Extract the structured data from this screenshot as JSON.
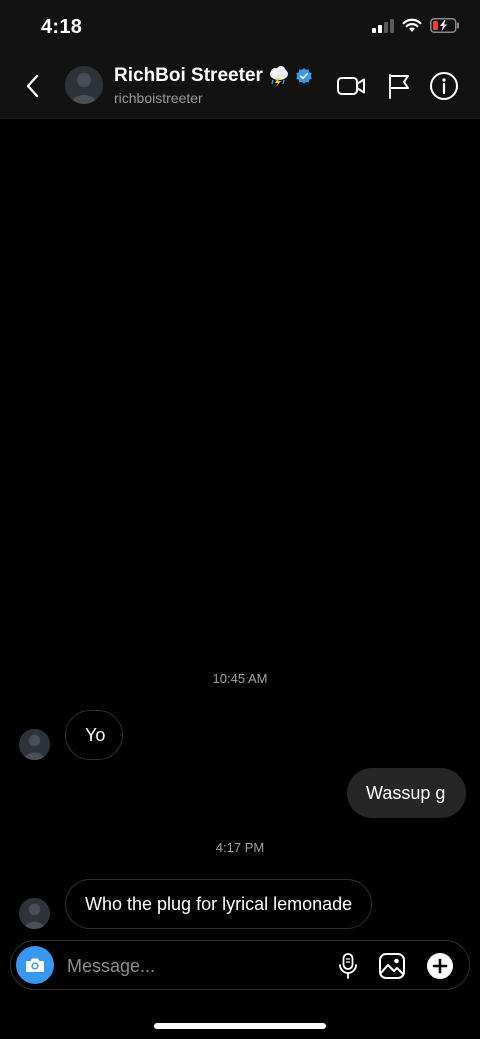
{
  "status_bar": {
    "time": "4:18"
  },
  "header": {
    "name": "RichBoi Streeter",
    "username": "richboistreeter"
  },
  "messages": [
    {
      "type": "timestamp",
      "text": "10:45 AM"
    },
    {
      "type": "incoming",
      "text": "Yo"
    },
    {
      "type": "outgoing",
      "text": "Wassup g"
    },
    {
      "type": "timestamp",
      "text": "4:17 PM"
    },
    {
      "type": "incoming",
      "text": "Who the plug for lyrical lemonade"
    }
  ],
  "composer": {
    "placeholder": "Message..."
  },
  "colors": {
    "accent": "#3897f0",
    "background": "#000000",
    "bar": "#121212",
    "outgoing_bubble": "#262626"
  },
  "icons": [
    "back-chevron-icon",
    "verified-badge-icon",
    "cloud-lightning-emoji",
    "video-call-icon",
    "flag-icon",
    "info-icon",
    "camera-icon",
    "microphone-icon",
    "gallery-icon",
    "plus-icon"
  ]
}
